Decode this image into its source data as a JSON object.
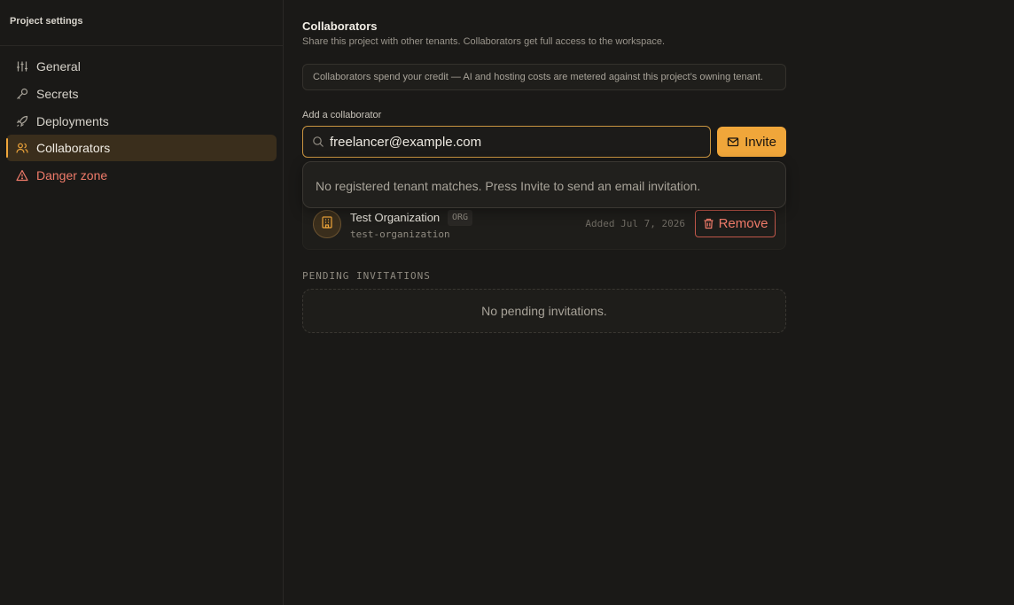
{
  "sidebar": {
    "title": "Project settings",
    "items": [
      {
        "label": "General",
        "icon": "sliders-icon"
      },
      {
        "label": "Secrets",
        "icon": "key-icon"
      },
      {
        "label": "Deployments",
        "icon": "rocket-icon"
      },
      {
        "label": "Collaborators",
        "icon": "users-icon",
        "active": true
      },
      {
        "label": "Danger zone",
        "icon": "warning-icon",
        "danger": true
      }
    ]
  },
  "main": {
    "title": "Collaborators",
    "subtitle": "Share this project with other tenants. Collaborators get full access to the workspace.",
    "notice": "Collaborators spend your credit — AI and hosting costs are metered against this project’s owning tenant.",
    "add_label": "Add a collaborator",
    "search_value": "freelancer@example.com",
    "invite_label": "Invite",
    "dropdown_message": "No registered tenant matches. Press Invite to send an email invitation.",
    "collaborator": {
      "name": "Test Organization",
      "badge": "ORG",
      "slug": "test-organization",
      "added": "Added Jul 7, 2026",
      "remove_label": "Remove"
    },
    "pending_label": "PENDING INVITATIONS",
    "pending_empty": "No pending invitations."
  },
  "colors": {
    "accent": "#f0a63a",
    "danger": "#f07b6a",
    "background": "#1a1917"
  }
}
